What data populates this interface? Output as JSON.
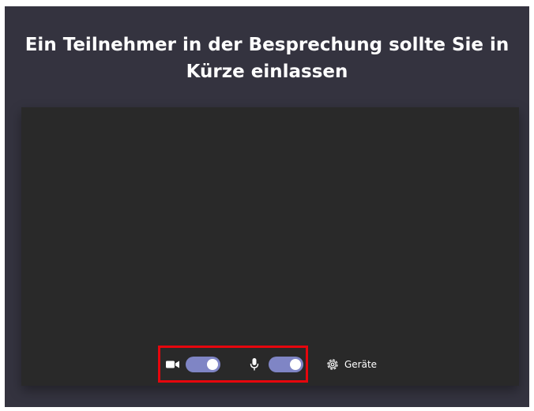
{
  "title": "Ein Teilnehmer in der Besprechung sollte Sie in Kürze einlassen",
  "controls": {
    "camera": {
      "icon": "video-camera-icon",
      "enabled": true
    },
    "microphone": {
      "icon": "microphone-icon",
      "enabled": true
    },
    "devices": {
      "icon": "gear-icon",
      "label": "Geräte"
    }
  },
  "colors": {
    "background": "#34333f",
    "preview": "#292929",
    "toggle_on": "#7f85c5",
    "highlight": "#e6060d"
  }
}
